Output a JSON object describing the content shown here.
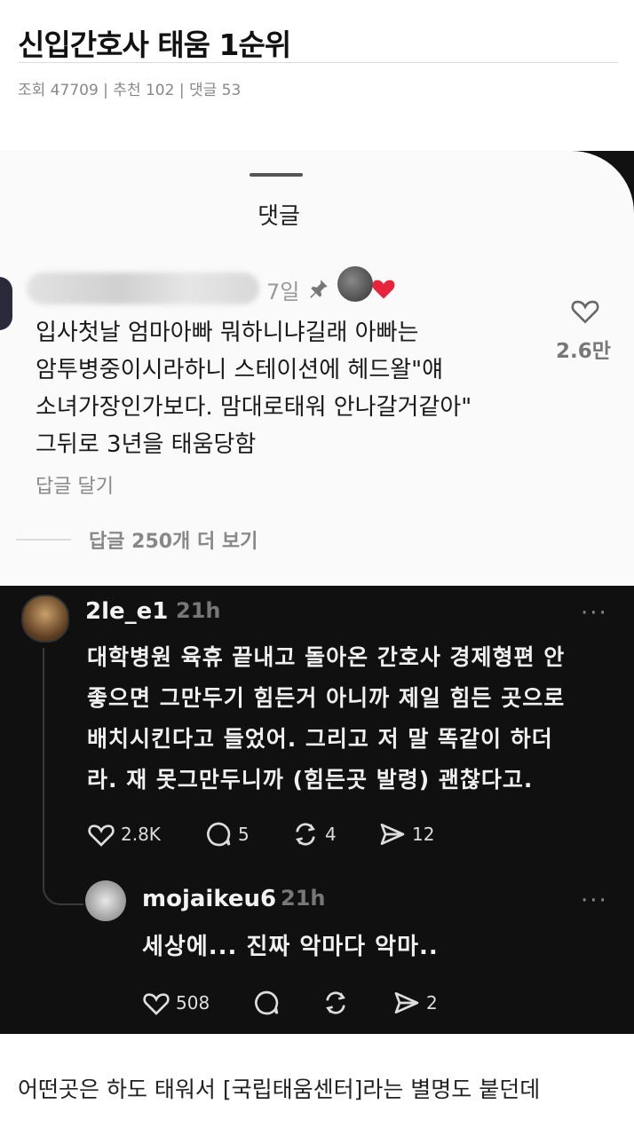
{
  "post": {
    "title": "신입간호사 태움 1순위",
    "meta": "조회 47709 | 추천 102 | 댓글 53"
  },
  "ig": {
    "sheet_title": "댓글",
    "comment_time": "7일",
    "comment_text": "입사첫날 엄마아빠 뭐하니냐길래 아빠는\n암투병중이시라하니 스테이션에 헤드왈\"얘\n소녀가장인가보다. 맘대로태워 안나갈거같아\"\n그뒤로 3년을 태움당함",
    "reply_link": "답글 달기",
    "like_count": "2.6만",
    "view_replies": "답글 250개 더 보기",
    "icons": [
      "pin-icon",
      "heart-icon"
    ],
    "accent_heart": "#e8243c"
  },
  "threads": {
    "username": "2le_e1",
    "time": "21h",
    "more": "···",
    "text": "대학병원 육휴 끝내고 돌아온 간호사 경제형편 안\n좋으면 그만두기 힘든거 아니까 제일 힘든 곳으로\n배치시킨다고 들었어. 그리고 저 말 똑같이 하더\n라. 재 못그만두니까 (힘든곳 발령) 괜찮다고.",
    "likes": "2.8K",
    "comments": "5",
    "reposts": "4",
    "shares": "12",
    "reply": {
      "username": "mojaikeu6",
      "time": "21h",
      "more": "···",
      "text": "세상에... 진짜 악마다 악마..",
      "likes": "508",
      "shares": "2"
    }
  },
  "footer": {
    "text": "어떤곳은 하도 태워서 [국립태움센터]라는 별명도 붙던데"
  }
}
